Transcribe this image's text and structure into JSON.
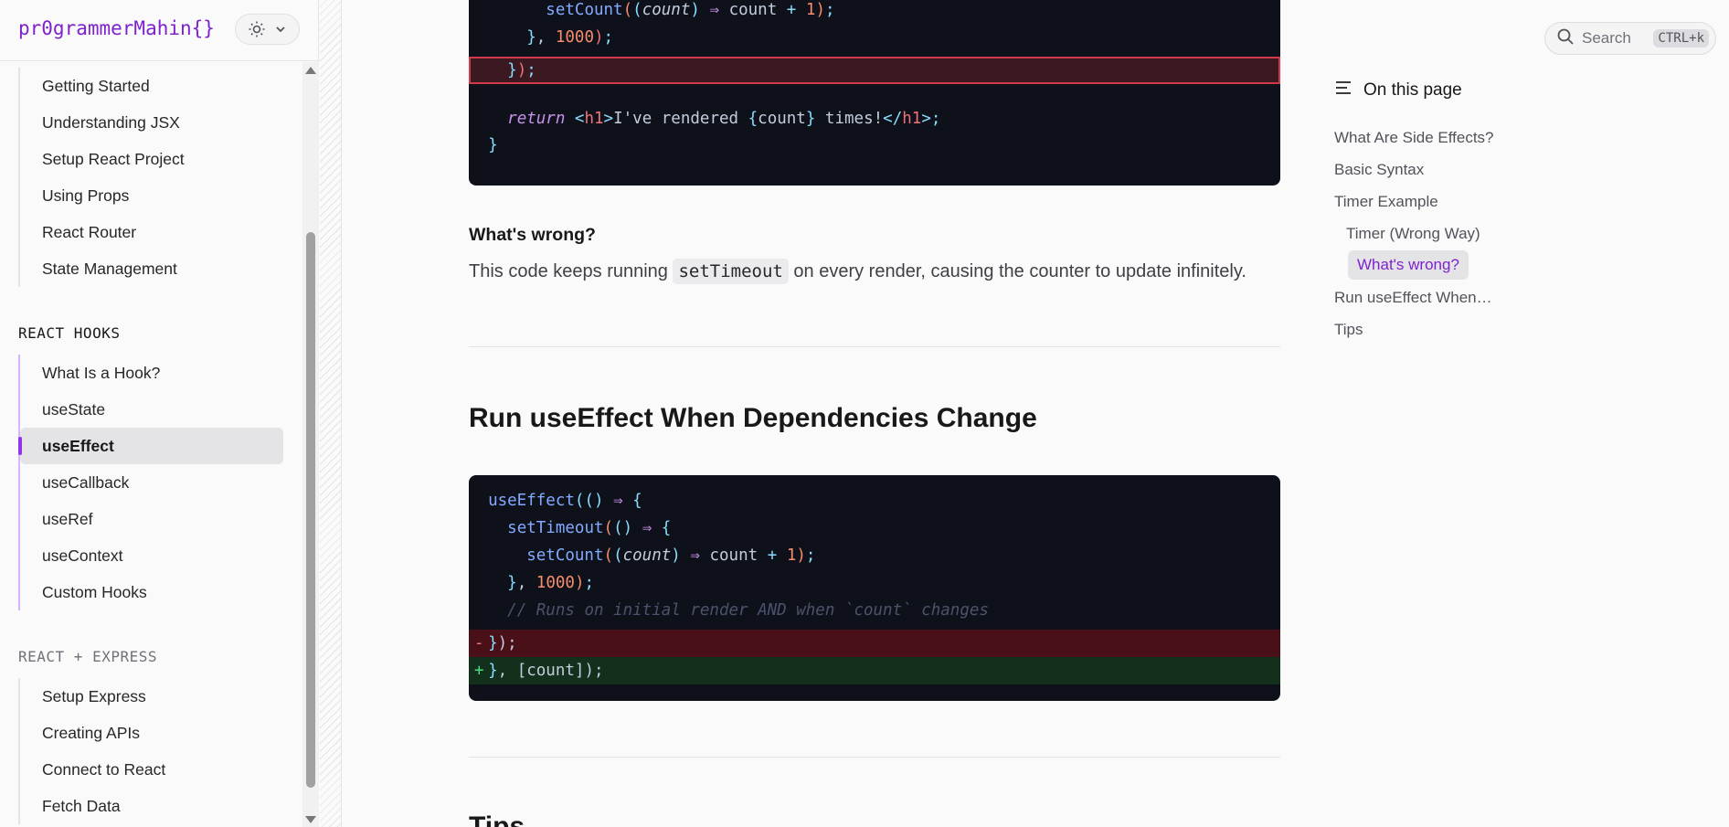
{
  "sidebar": {
    "logo": "pr0grammerMahin{}",
    "theme_icon": "sun-icon",
    "group1": [
      {
        "label": "Getting Started"
      },
      {
        "label": "Understanding JSX"
      },
      {
        "label": "Setup React Project"
      },
      {
        "label": "Using Props"
      },
      {
        "label": "React Router"
      },
      {
        "label": "State Management"
      }
    ],
    "hooks_title": "REACT HOOKS",
    "hooks": [
      {
        "label": "What Is a Hook?"
      },
      {
        "label": "useState"
      },
      {
        "label": "useEffect"
      },
      {
        "label": "useCallback"
      },
      {
        "label": "useRef"
      },
      {
        "label": "useContext"
      },
      {
        "label": "Custom Hooks"
      }
    ],
    "express_title": "REACT + EXPRESS",
    "express": [
      {
        "label": "Setup Express"
      },
      {
        "label": "Creating APIs"
      },
      {
        "label": "Connect to React"
      },
      {
        "label": "Fetch Data"
      }
    ],
    "active_item": "useEffect"
  },
  "main": {
    "wrong_heading": "What's wrong?",
    "para_before": "This code keeps running ",
    "para_code": "setTimeout",
    "para_after": " on every render, causing the counter to update infinitely.",
    "section_heading": "Run useEffect When Dependencies Change",
    "next_heading": "Tips",
    "comment_text": "// Runs on initial render AND when `count` changes"
  },
  "search": {
    "label": "Search",
    "shortcut": "CTRL+k"
  },
  "toc": {
    "title": "On this page",
    "items": [
      {
        "label": "What Are Side Effects?"
      },
      {
        "label": "Basic Syntax"
      },
      {
        "label": "Timer Example"
      },
      {
        "label": "Timer (Wrong Way)"
      },
      {
        "label": "What's wrong?"
      },
      {
        "label": "Run useEffect When…"
      },
      {
        "label": "Tips"
      }
    ]
  },
  "colors": {
    "accent": "#7e22ce",
    "code_bg": "#0f111a"
  }
}
